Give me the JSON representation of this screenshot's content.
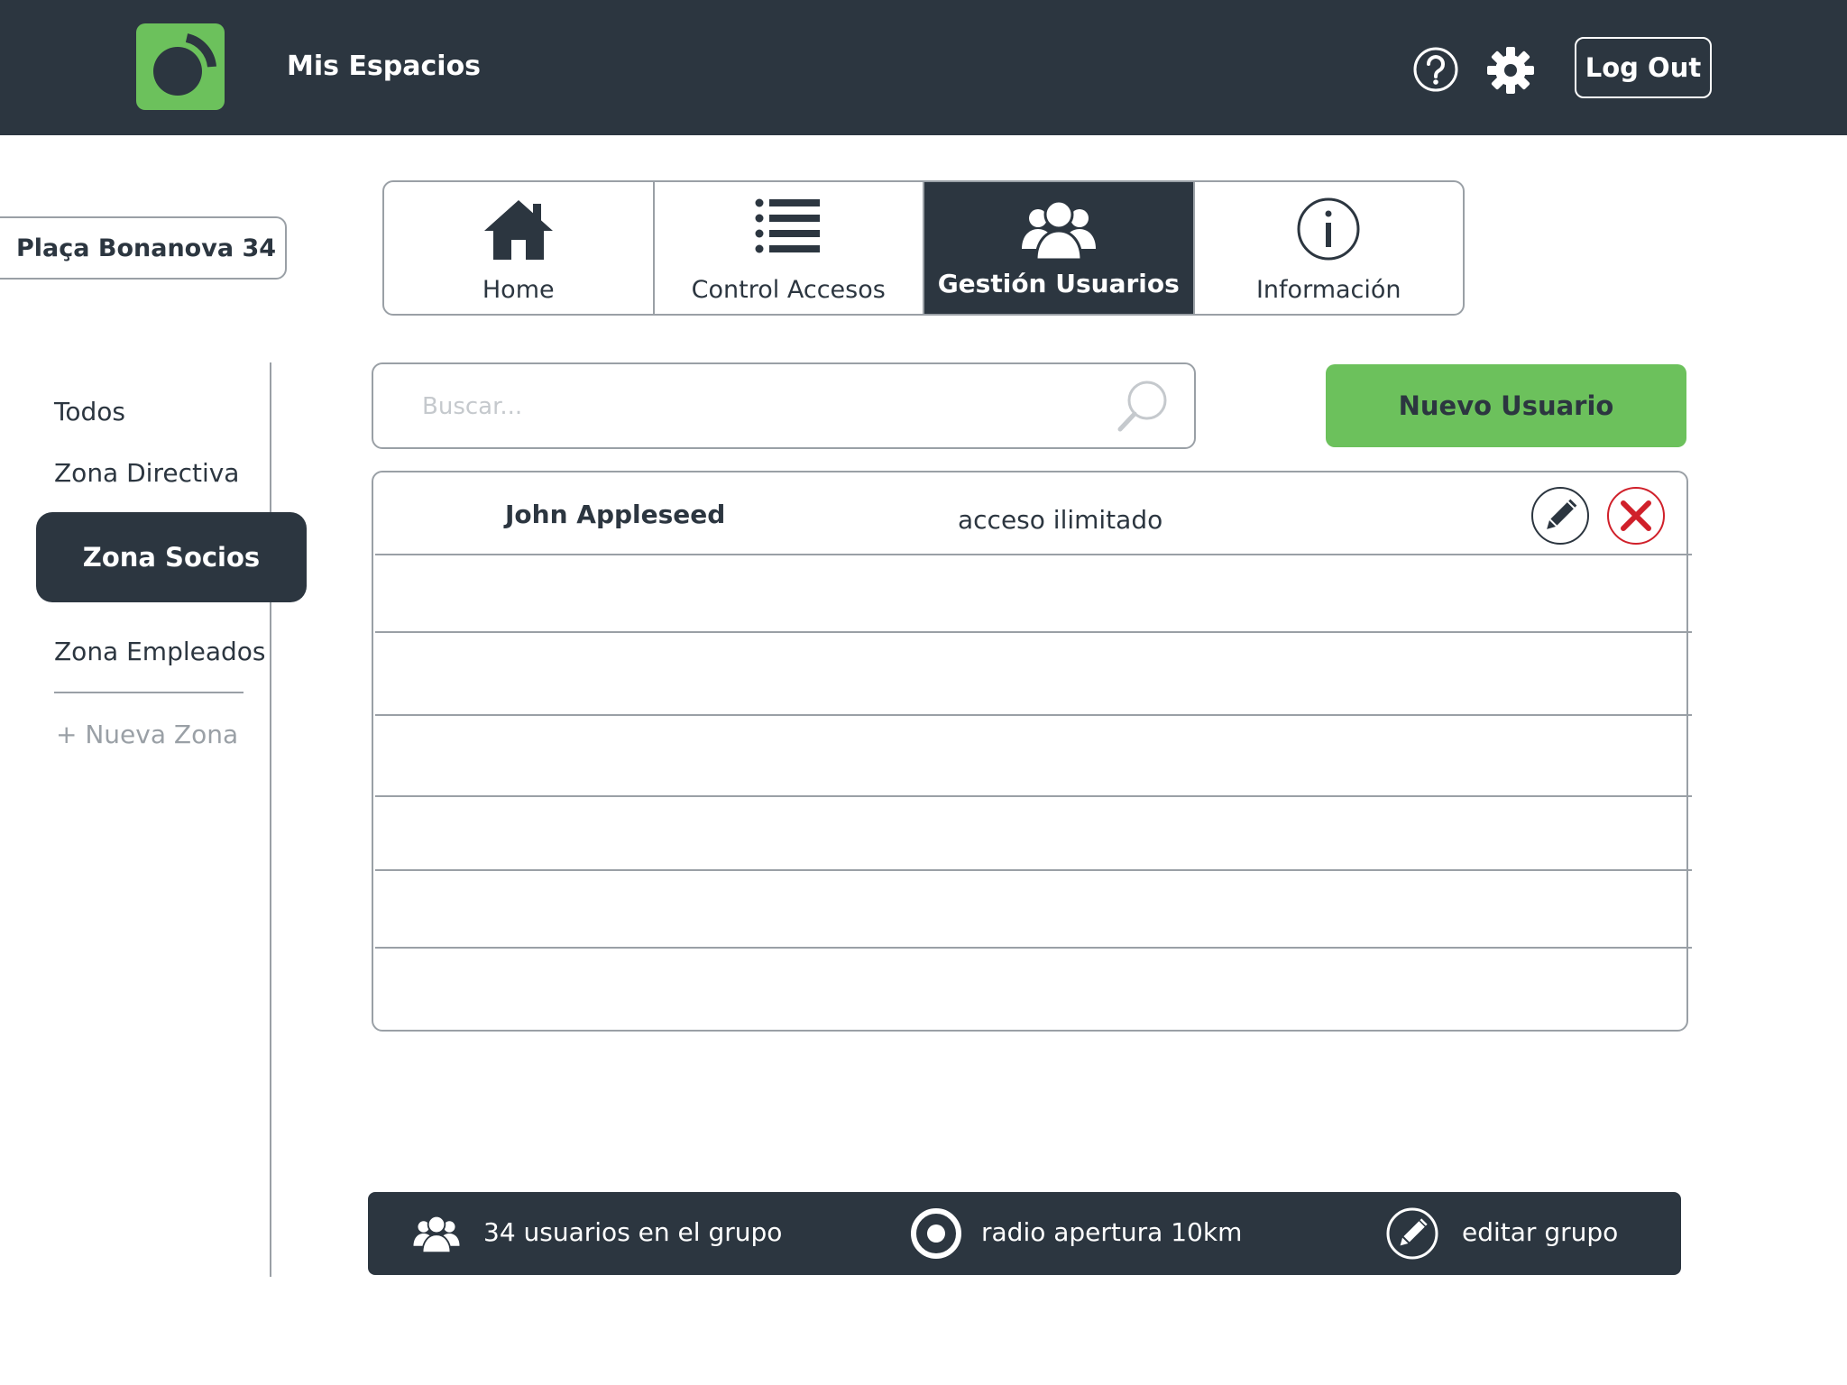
{
  "header": {
    "app_title": "Mis Espacios",
    "logout_label": "Log Out",
    "icons": [
      "app-logo-icon",
      "help-icon",
      "gear-icon"
    ]
  },
  "location": {
    "name": "Plaça Bonanova 34"
  },
  "tabs": [
    {
      "label": "Home",
      "icon": "home-icon",
      "active": false
    },
    {
      "label": "Control Accesos",
      "icon": "list-icon",
      "active": false
    },
    {
      "label": "Gestión Usuarios",
      "icon": "users-icon",
      "active": true
    },
    {
      "label": "Información",
      "icon": "info-icon",
      "active": false
    }
  ],
  "sidebar": {
    "zones": [
      {
        "label": "Todos",
        "active": false
      },
      {
        "label": "Zona Directiva",
        "active": false
      },
      {
        "label": "Zona Socios",
        "active": true
      },
      {
        "label": "Zona Empleados",
        "active": false
      }
    ],
    "new_zone_label": "+ Nueva Zona"
  },
  "search": {
    "placeholder": "Buscar...",
    "value": ""
  },
  "new_user_label": "Nuevo Usuario",
  "users": [
    {
      "name": "John Appleseed",
      "access": "acceso ilimitado"
    }
  ],
  "footer": {
    "user_count_text": "34 usuarios en el grupo",
    "radius_text": "radio apertura 10km",
    "edit_group_text": "editar grupo"
  },
  "colors": {
    "dark": "#2c3640",
    "accent_green": "#6cc15c",
    "border_gray": "#9aa0a6",
    "delete_red": "#d0202a"
  }
}
